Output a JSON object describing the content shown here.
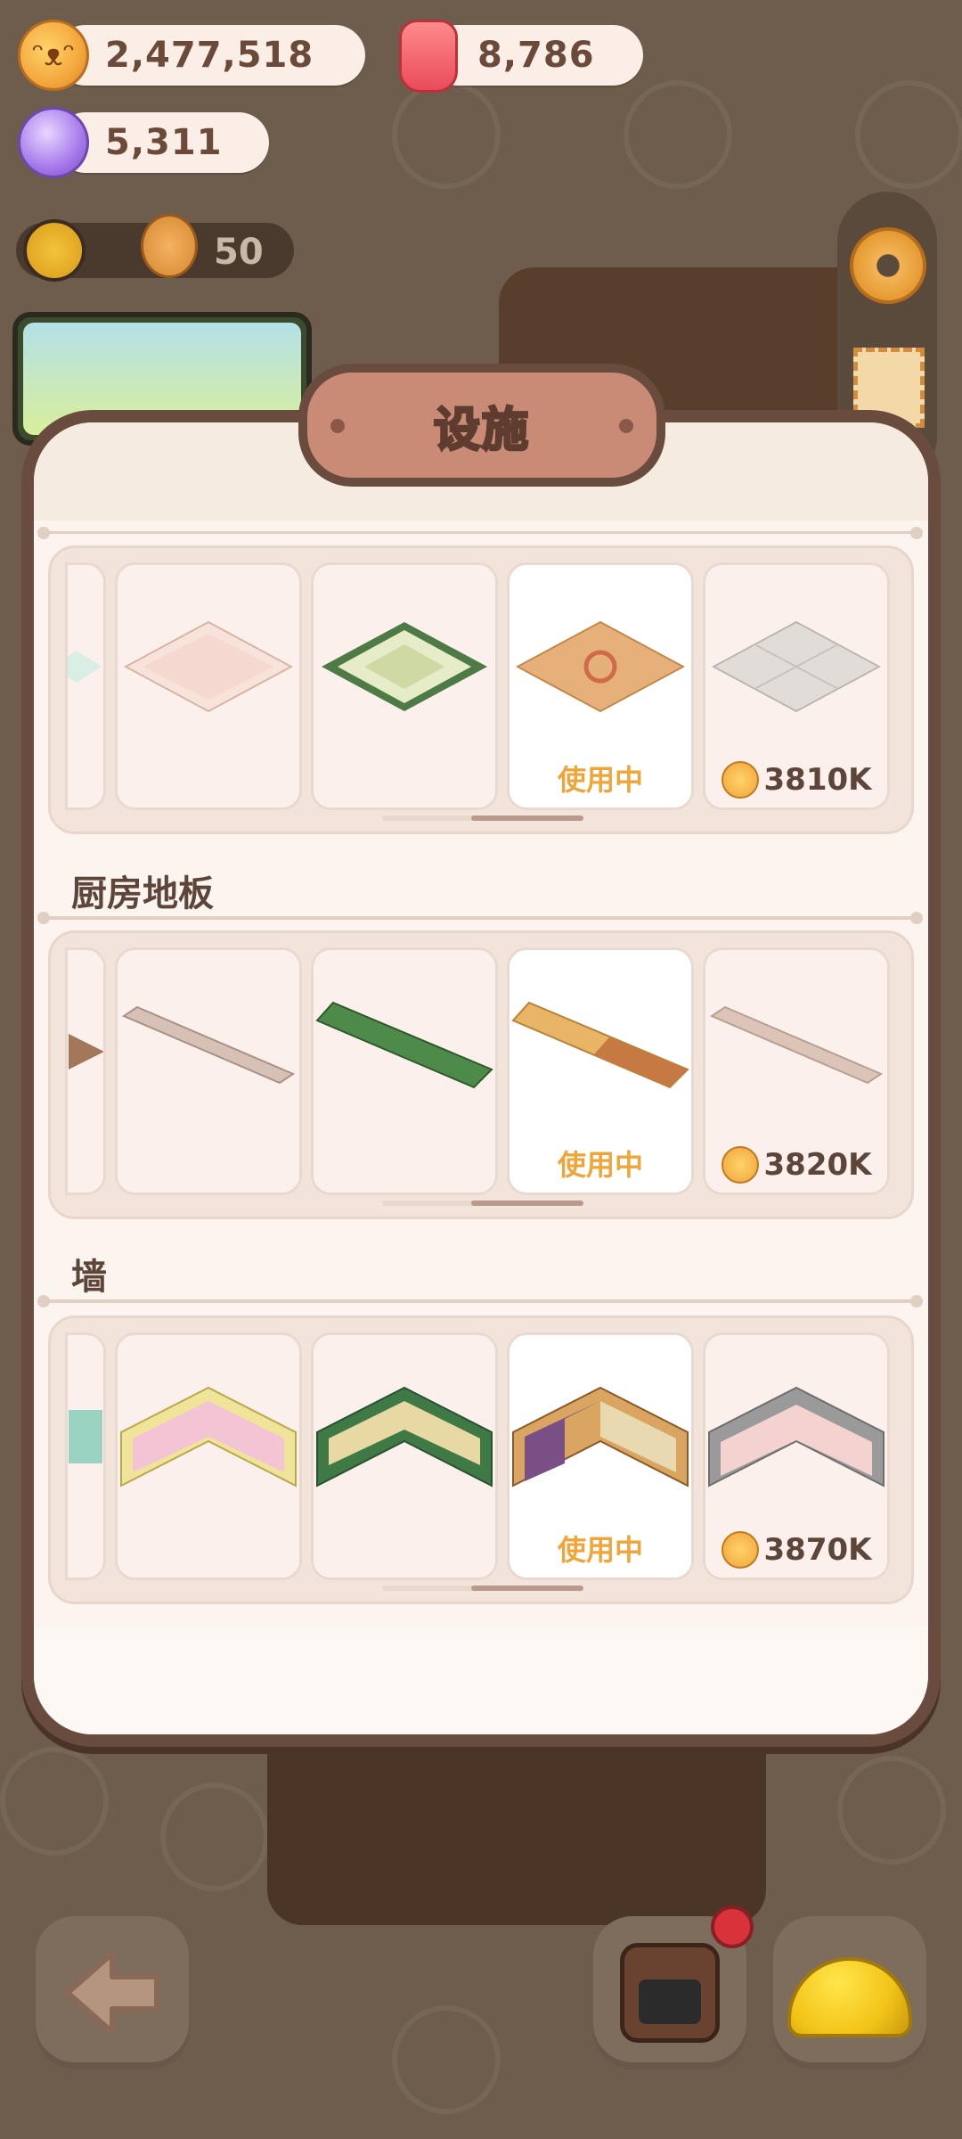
{
  "currencies": {
    "coins": "2,477,518",
    "jelly": "8,786",
    "crystals": "5,311"
  },
  "level": {
    "count": "50"
  },
  "modal": {
    "title": "设施",
    "sections": [
      {
        "title": "",
        "items": [
          {
            "status": ""
          },
          {
            "status": ""
          },
          {
            "status": "使用中"
          },
          {
            "price": "3810K"
          }
        ]
      },
      {
        "title": "厨房地板",
        "items": [
          {
            "status": ""
          },
          {
            "status": ""
          },
          {
            "status": "使用中"
          },
          {
            "price": "3820K"
          }
        ]
      },
      {
        "title": "墙",
        "items": [
          {
            "status": ""
          },
          {
            "status": ""
          },
          {
            "status": "使用中"
          },
          {
            "price": "3870K"
          }
        ]
      }
    ]
  },
  "icons": {
    "coin": "cookie-coin-icon",
    "jelly": "jelly-icon",
    "crystal": "crystal-icon",
    "settings": "gear-icon",
    "back": "back-arrow-icon",
    "oven": "oven-icon",
    "helmet": "hard-hat-icon"
  },
  "colors": {
    "accent": "#f0a53a",
    "modal_border": "#6a4c3f",
    "title_plate": "#c98b76",
    "notification": "#d8333a"
  }
}
